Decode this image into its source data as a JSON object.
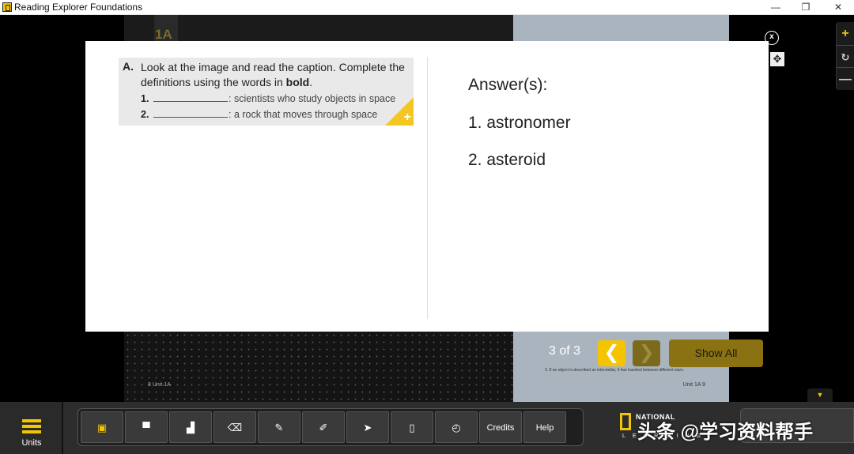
{
  "window": {
    "title": "Reading Explorer Foundations",
    "minimize": "—",
    "restore": "❐",
    "close": "✕"
  },
  "book": {
    "unit_heading": "1A",
    "left_footer": "8  Unit 1A",
    "right_footer": "Unit 1A  9",
    "right_footnote": "3. If an object is described as interstellar, it has traveled between different stars."
  },
  "exercise": {
    "letter": "A.",
    "instruction_pre": "Look at the image and read the caption. Complete the definitions using the words in ",
    "instruction_bold": "bold",
    "instruction_post": ".",
    "items": [
      {
        "num": "1.",
        "text": ": scientists who study objects in space"
      },
      {
        "num": "2.",
        "text": ": a rock that moves through space"
      }
    ],
    "expand_icon": "+"
  },
  "answers": {
    "heading": "Answer(s):",
    "list": [
      "1. astronomer",
      "2. asteroid"
    ]
  },
  "modal": {
    "close_label": "x",
    "move_icon": "✥"
  },
  "zoom": {
    "in": "+",
    "reset": "↻",
    "out": "—"
  },
  "pager": {
    "text": "3  of  3",
    "prev": "❮",
    "next": "❯",
    "show_all": "Show All"
  },
  "toolbar": {
    "units_label": "Units",
    "tools": [
      {
        "name": "sticky-note-icon",
        "glyph": "▣"
      },
      {
        "name": "spotlight-icon",
        "glyph": "▀"
      },
      {
        "name": "mask-icon",
        "glyph": "▟"
      },
      {
        "name": "eraser-icon",
        "glyph": "⌫"
      },
      {
        "name": "pen-icon",
        "glyph": "✎"
      },
      {
        "name": "highlighter-icon",
        "glyph": "✐"
      },
      {
        "name": "pointer-icon",
        "glyph": "➤"
      },
      {
        "name": "page-icon",
        "glyph": "▯"
      },
      {
        "name": "timer-icon",
        "glyph": "◴"
      }
    ],
    "credits": "Credits",
    "help": "Help",
    "down_arrow": "▼"
  },
  "logo": {
    "line1": "NATIONAL",
    "line2": "LEARNING"
  },
  "watermark": "头条 @学习资料帮手",
  "colors": {
    "accent": "#f4c400",
    "accent_dark": "#8a7212",
    "background": "#000000",
    "modal_bg": "#ffffff"
  }
}
